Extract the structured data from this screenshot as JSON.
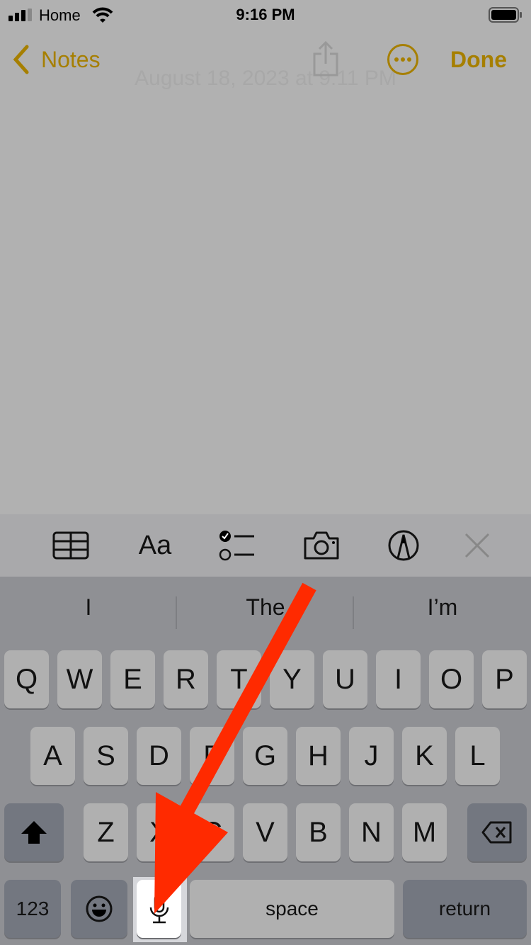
{
  "status_bar": {
    "carrier": "Home",
    "time": "9:16 PM"
  },
  "nav": {
    "back_label": "Notes",
    "done_label": "Done",
    "note_date": "August 18, 2023 at 9:11 PM"
  },
  "colors": {
    "accent": "#a67f00",
    "annotation_arrow": "#ff2a00",
    "background": "#b1b1b1"
  },
  "toolbar": {
    "icons": [
      "table-icon",
      "format-text-icon",
      "checklist-icon",
      "camera-icon",
      "markup-pen-icon",
      "close-icon"
    ],
    "format_label": "Aa"
  },
  "suggestions": [
    "I",
    "The",
    "I’m"
  ],
  "keyboard": {
    "row1": [
      "Q",
      "W",
      "E",
      "R",
      "T",
      "Y",
      "U",
      "I",
      "O",
      "P"
    ],
    "row2": [
      "A",
      "S",
      "D",
      "F",
      "G",
      "H",
      "J",
      "K",
      "L"
    ],
    "row3": [
      "Z",
      "X",
      "C",
      "V",
      "B",
      "N",
      "M"
    ],
    "numbers_label": "123",
    "space_label": "space",
    "return_label": "return"
  }
}
